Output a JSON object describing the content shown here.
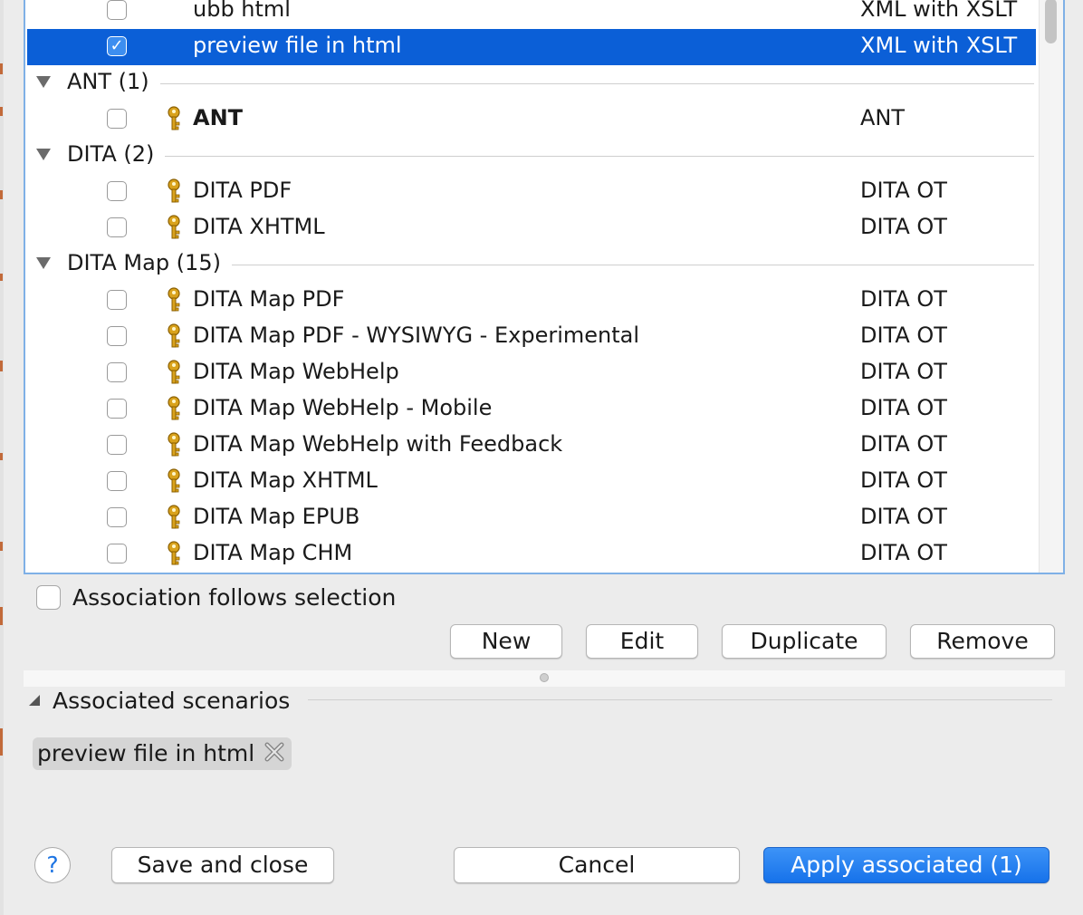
{
  "scenario_list": {
    "entries": [
      {
        "kind": "row",
        "name": "ubb html",
        "type": "XML with XSLT",
        "checked": false,
        "selected": false,
        "has_key": false
      },
      {
        "kind": "row",
        "name": "preview file in html",
        "type": "XML with XSLT",
        "checked": true,
        "selected": true,
        "has_key": false
      },
      {
        "kind": "group",
        "label": "ANT (1)"
      },
      {
        "kind": "row",
        "name": "ANT",
        "type": "ANT",
        "checked": false,
        "selected": false,
        "has_key": true,
        "bold": true
      },
      {
        "kind": "group",
        "label": "DITA (2)"
      },
      {
        "kind": "row",
        "name": "DITA PDF",
        "type": "DITA OT",
        "checked": false,
        "selected": false,
        "has_key": true
      },
      {
        "kind": "row",
        "name": "DITA XHTML",
        "type": "DITA OT",
        "checked": false,
        "selected": false,
        "has_key": true
      },
      {
        "kind": "group",
        "label": "DITA Map (15)"
      },
      {
        "kind": "row",
        "name": "DITA Map PDF",
        "type": "DITA OT",
        "checked": false,
        "selected": false,
        "has_key": true
      },
      {
        "kind": "row",
        "name": "DITA Map PDF - WYSIWYG - Experimental",
        "type": "DITA OT",
        "checked": false,
        "selected": false,
        "has_key": true
      },
      {
        "kind": "row",
        "name": "DITA Map WebHelp",
        "type": "DITA OT",
        "checked": false,
        "selected": false,
        "has_key": true
      },
      {
        "kind": "row",
        "name": "DITA Map WebHelp - Mobile",
        "type": "DITA OT",
        "checked": false,
        "selected": false,
        "has_key": true
      },
      {
        "kind": "row",
        "name": "DITA Map WebHelp with Feedback",
        "type": "DITA OT",
        "checked": false,
        "selected": false,
        "has_key": true
      },
      {
        "kind": "row",
        "name": "DITA Map XHTML",
        "type": "DITA OT",
        "checked": false,
        "selected": false,
        "has_key": true
      },
      {
        "kind": "row",
        "name": "DITA Map EPUB",
        "type": "DITA OT",
        "checked": false,
        "selected": false,
        "has_key": true
      },
      {
        "kind": "row",
        "name": "DITA Map CHM",
        "type": "DITA OT",
        "checked": false,
        "selected": false,
        "has_key": true
      }
    ]
  },
  "association": {
    "label": "Association follows selection",
    "checked": false
  },
  "actions": {
    "new": "New",
    "edit": "Edit",
    "duplicate": "Duplicate",
    "remove": "Remove"
  },
  "associated": {
    "heading": "Associated scenarios",
    "chips": [
      {
        "label": "preview file in html"
      }
    ]
  },
  "footer": {
    "help": "?",
    "save_close": "Save and close",
    "cancel": "Cancel",
    "apply": "Apply associated (1)"
  },
  "colors": {
    "selection": "#0b5fd7",
    "key_icon": "#d9a21c",
    "primary_button": "#1672ea",
    "focus_border": "#7fb0e6"
  }
}
